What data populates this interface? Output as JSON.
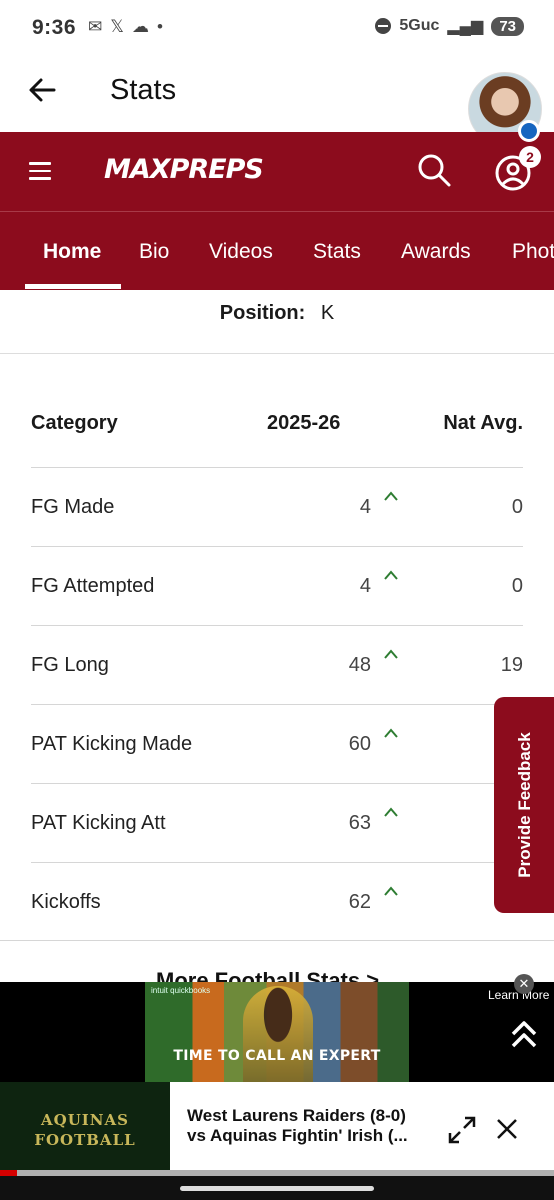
{
  "status_bar": {
    "time": "9:36",
    "network": "5Guc",
    "battery": "73"
  },
  "app_bar": {
    "title": "Stats"
  },
  "maxpreps": {
    "logo": "MAXPREPS",
    "notifications": "2"
  },
  "tabs": [
    {
      "label": "Home",
      "active": true
    },
    {
      "label": "Bio",
      "active": false
    },
    {
      "label": "Videos",
      "active": false
    },
    {
      "label": "Stats",
      "active": false
    },
    {
      "label": "Awards",
      "active": false
    },
    {
      "label": "Photos",
      "active": false
    }
  ],
  "position": {
    "label": "Position:",
    "value": "K"
  },
  "table": {
    "headers": [
      "Category",
      "2025-26",
      "Nat Avg."
    ],
    "rows": [
      {
        "category": "FG Made",
        "season": "4",
        "nat_avg": "0",
        "trend": "up"
      },
      {
        "category": "FG Attempted",
        "season": "4",
        "nat_avg": "0",
        "trend": "up"
      },
      {
        "category": "FG Long",
        "season": "48",
        "nat_avg": "19",
        "trend": "up"
      },
      {
        "category": "PAT Kicking Made",
        "season": "60",
        "nat_avg": "",
        "trend": "up"
      },
      {
        "category": "PAT Kicking Att",
        "season": "63",
        "nat_avg": "",
        "trend": "up"
      },
      {
        "category": "Kickoffs",
        "season": "62",
        "nat_avg": "",
        "trend": "up"
      }
    ]
  },
  "more_link": "More Football Stats >",
  "feedback": "Provide Feedback",
  "ad": {
    "brand": "intuit quickbooks",
    "caption": "TIME TO CALL AN EXPERT",
    "learn_more": "Learn More",
    "close": "✕"
  },
  "player": {
    "thumb_text": "AQUINAS FOOTBALL",
    "title": "West Laurens Raiders (8-0) vs Aquinas Fightin' Irish (...",
    "progress": 0.03
  },
  "colors": {
    "brand": "#8c0c1d",
    "trend_up": "#2e7d32"
  }
}
